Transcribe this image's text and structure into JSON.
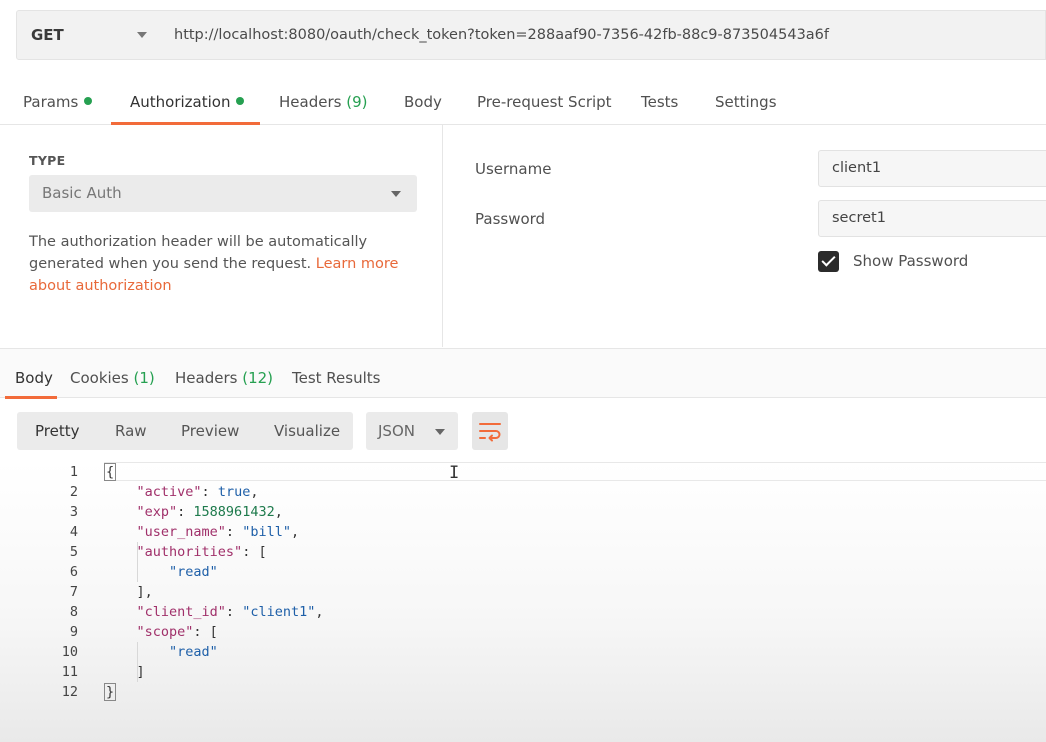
{
  "request": {
    "method": "GET",
    "url": "http://localhost:8080/oauth/check_token?token=288aaf90-7356-42fb-88c9-873504543a6f"
  },
  "request_tabs": [
    {
      "label": "Params",
      "count": "",
      "dot": true
    },
    {
      "label": "Authorization",
      "count": "",
      "dot": true
    },
    {
      "label": "Headers",
      "count": "(9)",
      "dot": false
    },
    {
      "label": "Body",
      "count": "",
      "dot": false
    },
    {
      "label": "Pre-request Script",
      "count": "",
      "dot": false
    },
    {
      "label": "Tests",
      "count": "",
      "dot": false
    },
    {
      "label": "Settings",
      "count": "",
      "dot": false
    }
  ],
  "auth": {
    "type_label": "TYPE",
    "type_value": "Basic Auth",
    "description": "The authorization header will be automatically generated when you send the request.",
    "learn_more": "Learn more about authorization",
    "username_label": "Username",
    "username_value": "client1",
    "password_label": "Password",
    "password_value": "secret1",
    "show_password_label": "Show Password",
    "show_password_checked": true
  },
  "response_tabs": [
    {
      "label": "Body",
      "count": ""
    },
    {
      "label": "Cookies",
      "count": "(1)"
    },
    {
      "label": "Headers",
      "count": "(12)"
    },
    {
      "label": "Test Results",
      "count": ""
    }
  ],
  "view_modes": [
    "Pretty",
    "Raw",
    "Preview",
    "Visualize"
  ],
  "format": "JSON",
  "icons": {
    "wrap": "wrap-lines-icon",
    "dropdown": "chevron-down-icon"
  },
  "colors": {
    "accent": "#f26b3a",
    "success": "#26a051"
  },
  "editor": {
    "line_numbers": [
      "1",
      "2",
      "3",
      "4",
      "5",
      "6",
      "7",
      "8",
      "9",
      "10",
      "11",
      "12"
    ],
    "lines": [
      "{",
      "    \"active\": true,",
      "    \"exp\": 1588961432,",
      "    \"user_name\": \"bill\",",
      "    \"authorities\": [",
      "        \"read\"",
      "    ],",
      "    \"client_id\": \"client1\",",
      "    \"scope\": [",
      "        \"read\"",
      "    ]",
      "}"
    ]
  }
}
